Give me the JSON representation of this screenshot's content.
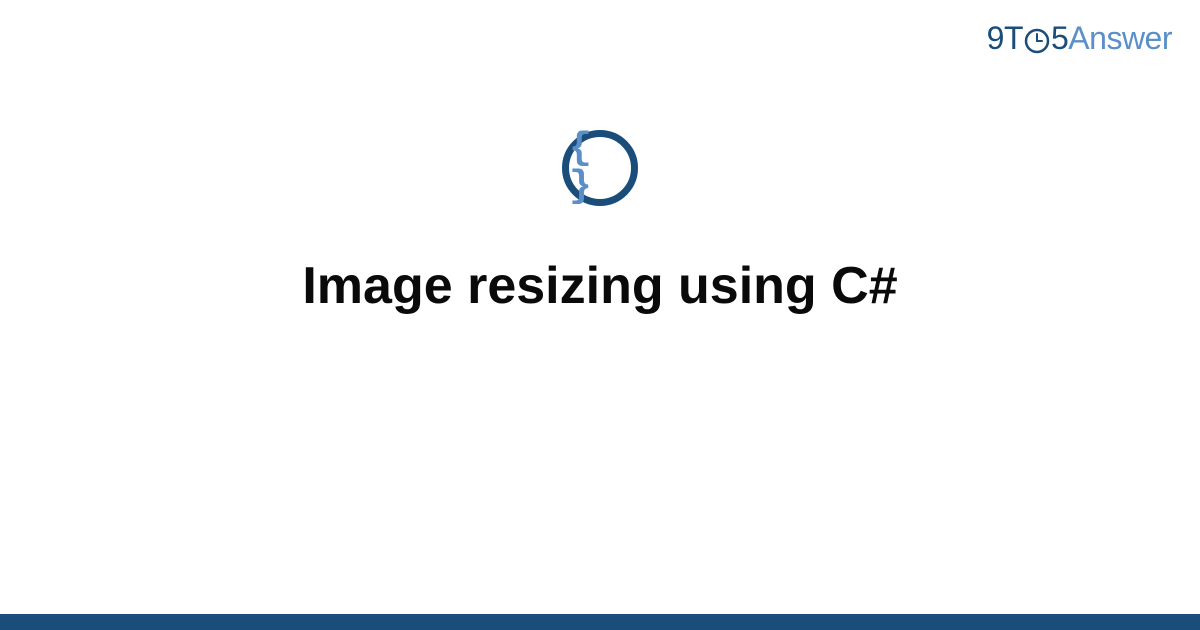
{
  "header": {
    "logo": {
      "part1": "9T",
      "part2": "5",
      "part3": "Answer"
    }
  },
  "main": {
    "icon_content": "{ }",
    "title": "Image resizing using C#"
  },
  "colors": {
    "dark_blue": "#1a4d7a",
    "light_blue": "#5a8fc7",
    "text": "#0a0a0a"
  }
}
